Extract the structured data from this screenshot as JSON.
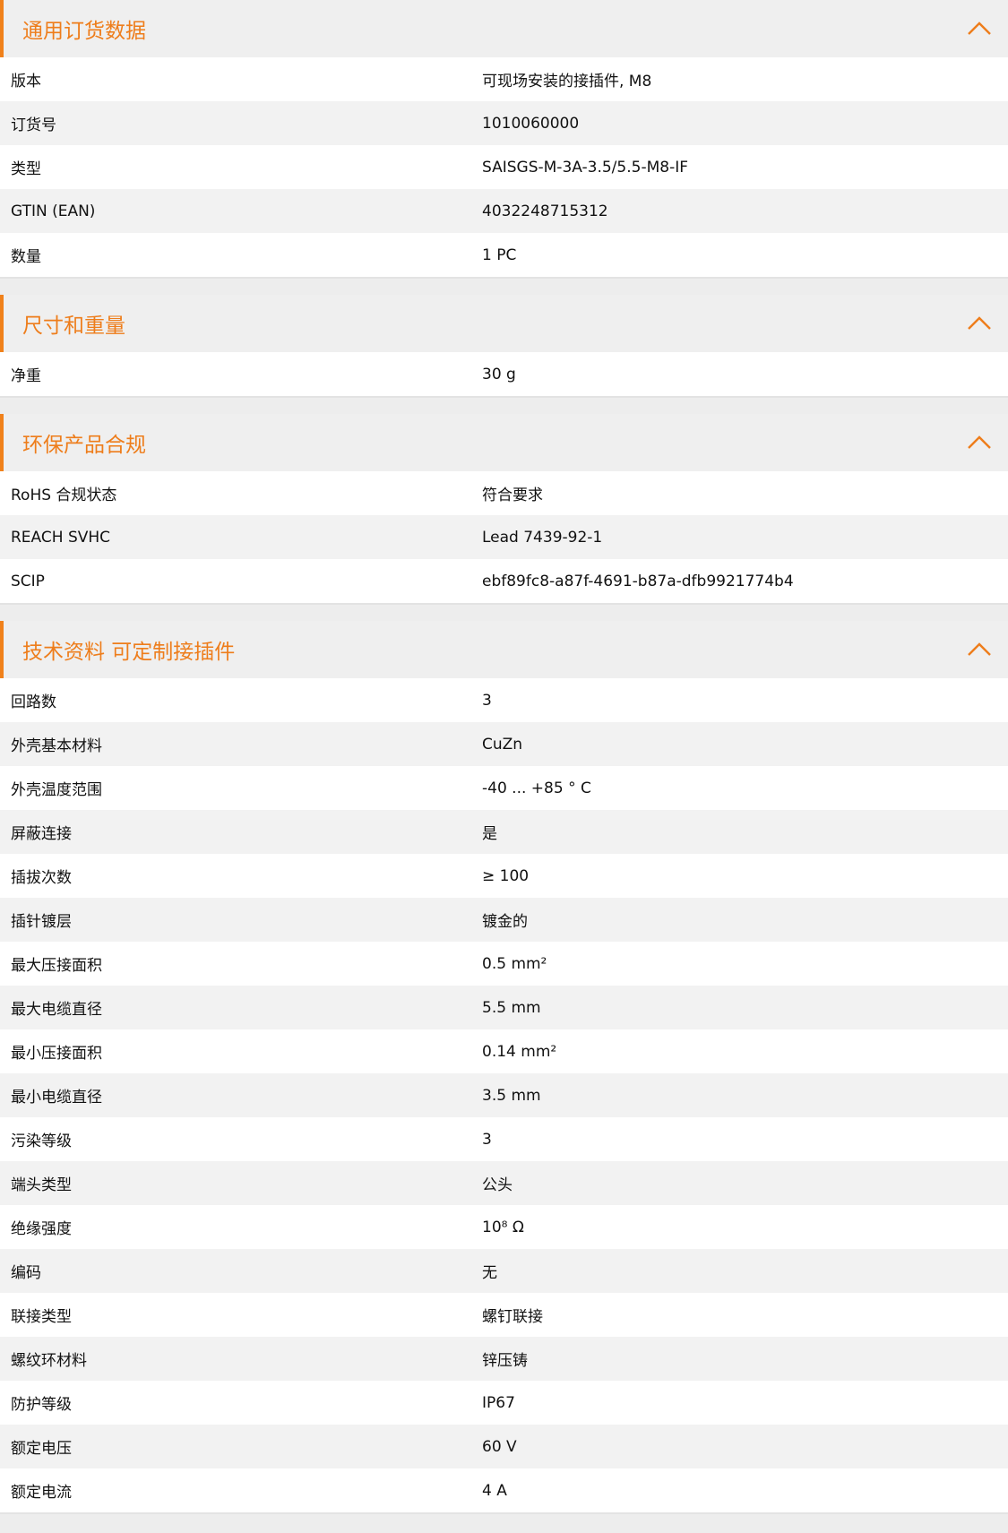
{
  "sections": [
    {
      "title": "通用订货数据",
      "rows": [
        {
          "label": "版本",
          "value": "可现场安装的接插件, M8"
        },
        {
          "label": "订货号",
          "value": "1010060000"
        },
        {
          "label": "类型",
          "value": "SAISGS-M-3A-3.5/5.5-M8-IF"
        },
        {
          "label": "GTIN (EAN)",
          "value": "4032248715312"
        },
        {
          "label": "数量",
          "value": "1  PC"
        }
      ]
    },
    {
      "title": "尺寸和重量",
      "rows": [
        {
          "label": "净重",
          "value": "30  g"
        }
      ]
    },
    {
      "title": "环保产品合规",
      "rows": [
        {
          "label": "RoHS 合规状态",
          "value": "符合要求"
        },
        {
          "label": "REACH SVHC",
          "value": "Lead 7439-92-1"
        },
        {
          "label": "SCIP",
          "value": "ebf89fc8-a87f-4691-b87a-dfb9921774b4"
        }
      ]
    },
    {
      "title": "技术资料 可定制接插件",
      "rows": [
        {
          "label": "回路数",
          "value": "3"
        },
        {
          "label": "外壳基本材料",
          "value": "CuZn"
        },
        {
          "label": "外壳温度范围",
          "value": "-40 ... +85 ° C"
        },
        {
          "label": "屏蔽连接",
          "value": "是"
        },
        {
          "label": "插拔次数",
          "value": "≥ 100"
        },
        {
          "label": "插针镀层",
          "value": "镀金的"
        },
        {
          "label": "最大压接面积",
          "value": "0.5  mm²"
        },
        {
          "label": "最大电缆直径",
          "value": "5.5  mm"
        },
        {
          "label": "最小压接面积",
          "value": "0.14  mm²"
        },
        {
          "label": "最小电缆直径",
          "value": "3.5  mm"
        },
        {
          "label": "污染等级",
          "value": "3"
        },
        {
          "label": "端头类型",
          "value": "公头"
        },
        {
          "label": "绝缘强度",
          "value": "10⁸ Ω"
        },
        {
          "label": "编码",
          "value": "无"
        },
        {
          "label": "联接类型",
          "value": "螺钉联接"
        },
        {
          "label": "螺纹环材料",
          "value": "锌压铸"
        },
        {
          "label": "防护等级",
          "value": "IP67"
        },
        {
          "label": "额定电压",
          "value": "60  V"
        },
        {
          "label": "额定电流",
          "value": "4  A"
        }
      ]
    }
  ],
  "colors": {
    "accent": "#ee7d1b"
  },
  "icons": {
    "toggle": "chevron-up-icon"
  }
}
